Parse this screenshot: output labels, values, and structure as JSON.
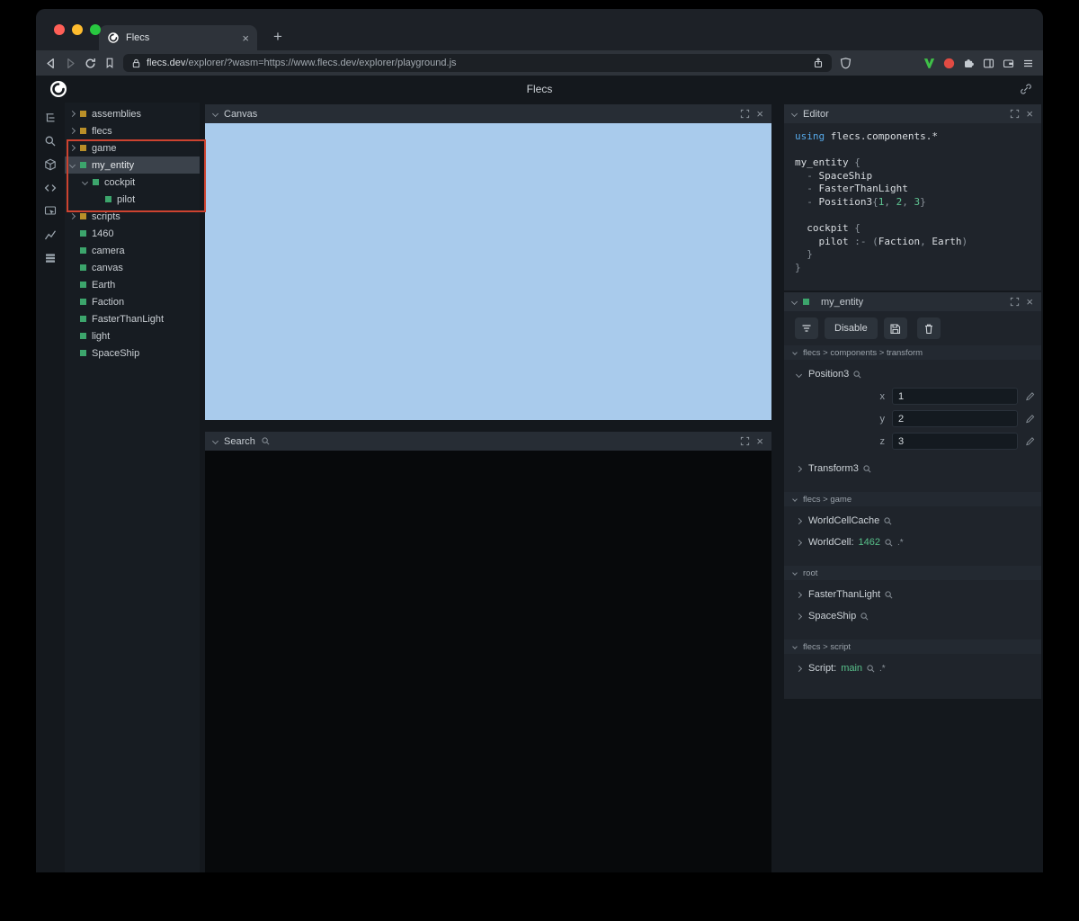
{
  "browser": {
    "tab_title": "Flecs",
    "url_domain": "flecs.dev",
    "url_path": "/explorer/?wasm=https://www.flecs.dev/explorer/playground.js"
  },
  "app": {
    "title": "Flecs"
  },
  "sidebar_icons": [
    "hierarchy-icon",
    "search-icon",
    "entities-icon",
    "code-icon",
    "inspect-icon",
    "stats-icon",
    "queries-icon"
  ],
  "tree": {
    "items": [
      {
        "label": "assemblies",
        "color": "orange",
        "expander": "right",
        "indent": 0,
        "selected": false
      },
      {
        "label": "flecs",
        "color": "orange",
        "expander": "right",
        "indent": 0,
        "selected": false
      },
      {
        "label": "game",
        "color": "orange",
        "expander": "right",
        "indent": 0,
        "selected": false
      },
      {
        "label": "my_entity",
        "color": "green",
        "expander": "down",
        "indent": 0,
        "selected": true
      },
      {
        "label": "cockpit",
        "color": "green",
        "expander": "down",
        "indent": 1,
        "selected": false
      },
      {
        "label": "pilot",
        "color": "green",
        "expander": "none",
        "indent": 2,
        "selected": false
      },
      {
        "label": "scripts",
        "color": "orange",
        "expander": "right",
        "indent": 0,
        "selected": false
      },
      {
        "label": "1460",
        "color": "green",
        "expander": "none",
        "indent": 0,
        "selected": false
      },
      {
        "label": "camera",
        "color": "green",
        "expander": "none",
        "indent": 0,
        "selected": false
      },
      {
        "label": "canvas",
        "color": "green",
        "expander": "none",
        "indent": 0,
        "selected": false
      },
      {
        "label": "Earth",
        "color": "green",
        "expander": "none",
        "indent": 0,
        "selected": false
      },
      {
        "label": "Faction",
        "color": "green",
        "expander": "none",
        "indent": 0,
        "selected": false
      },
      {
        "label": "FasterThanLight",
        "color": "green",
        "expander": "none",
        "indent": 0,
        "selected": false
      },
      {
        "label": "light",
        "color": "green",
        "expander": "none",
        "indent": 0,
        "selected": false
      },
      {
        "label": "SpaceShip",
        "color": "green",
        "expander": "none",
        "indent": 0,
        "selected": false
      }
    ]
  },
  "panels": {
    "canvas": {
      "title": "Canvas"
    },
    "search": {
      "title": "Search"
    },
    "editor": {
      "title": "Editor"
    },
    "inspector": {
      "title": "my_entity"
    }
  },
  "editor": {
    "lines": [
      {
        "segs": [
          {
            "t": "using",
            "c": "kw"
          },
          {
            "t": " flecs.components.*",
            "c": "def"
          }
        ]
      },
      {
        "segs": []
      },
      {
        "segs": [
          {
            "t": "my_entity ",
            "c": "def"
          },
          {
            "t": "{",
            "c": "pun"
          }
        ]
      },
      {
        "segs": [
          {
            "t": "  - ",
            "c": "pun"
          },
          {
            "t": "SpaceShip",
            "c": "def"
          }
        ]
      },
      {
        "segs": [
          {
            "t": "  - ",
            "c": "pun"
          },
          {
            "t": "FasterThanLight",
            "c": "def"
          }
        ]
      },
      {
        "segs": [
          {
            "t": "  - ",
            "c": "pun"
          },
          {
            "t": "Position3",
            "c": "def"
          },
          {
            "t": "{",
            "c": "pun"
          },
          {
            "t": "1",
            "c": "num"
          },
          {
            "t": ", ",
            "c": "pun"
          },
          {
            "t": "2",
            "c": "num"
          },
          {
            "t": ", ",
            "c": "pun"
          },
          {
            "t": "3",
            "c": "num"
          },
          {
            "t": "}",
            "c": "pun"
          }
        ]
      },
      {
        "segs": []
      },
      {
        "segs": [
          {
            "t": "  cockpit ",
            "c": "def"
          },
          {
            "t": "{",
            "c": "pun"
          }
        ]
      },
      {
        "segs": [
          {
            "t": "    pilot ",
            "c": "def"
          },
          {
            "t": ":- ",
            "c": "pun"
          },
          {
            "t": "(",
            "c": "pun"
          },
          {
            "t": "Faction",
            "c": "def"
          },
          {
            "t": ", ",
            "c": "pun"
          },
          {
            "t": "Earth",
            "c": "def"
          },
          {
            "t": ")",
            "c": "pun"
          }
        ]
      },
      {
        "segs": [
          {
            "t": "  }",
            "c": "pun"
          }
        ]
      },
      {
        "segs": [
          {
            "t": "}",
            "c": "pun"
          }
        ]
      }
    ]
  },
  "inspector": {
    "toolbar": {
      "disable_label": "Disable"
    },
    "groups": [
      {
        "path": "flecs > components > transform",
        "rows": [
          {
            "name": "Position3",
            "expanded": true,
            "has_search": true,
            "fields": [
              {
                "label": "x",
                "value": "1"
              },
              {
                "label": "y",
                "value": "2"
              },
              {
                "label": "z",
                "value": "3"
              }
            ]
          },
          {
            "name": "Transform3",
            "expanded": false,
            "has_search": true
          }
        ]
      },
      {
        "path": "flecs > game",
        "rows": [
          {
            "name": "WorldCellCache",
            "expanded": false,
            "has_search": true
          },
          {
            "name": "WorldCell:",
            "value": "1462",
            "expanded": false,
            "has_search": true,
            "suffix": ".*"
          }
        ]
      },
      {
        "path": "root",
        "rows": [
          {
            "name": "FasterThanLight",
            "expanded": false,
            "has_search": true
          },
          {
            "name": "SpaceShip",
            "expanded": false,
            "has_search": true
          }
        ]
      },
      {
        "path": "flecs > script",
        "rows": [
          {
            "name": "Script:",
            "value": "main",
            "expanded": false,
            "has_search": true,
            "suffix": ".*"
          }
        ]
      }
    ]
  },
  "colors": {
    "accent_green": "#3ca56c",
    "module_orange": "#b98f28",
    "canvas_blue": "#a9cbec",
    "annotation_red": "#cd4330",
    "code_keyword_blue": "#56a8e8",
    "code_number_green": "#5fc492",
    "value_green": "#58c08a",
    "traffic_red": "#ff5f57",
    "traffic_yellow": "#febc2e",
    "traffic_green": "#28c840"
  }
}
